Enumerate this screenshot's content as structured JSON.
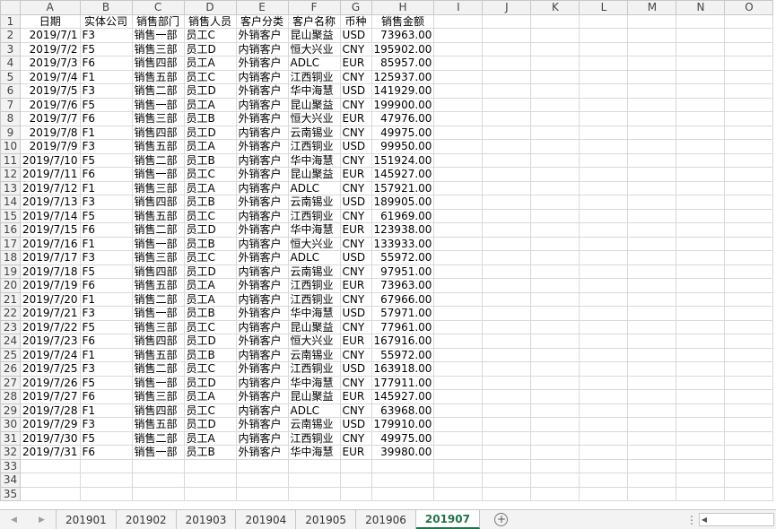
{
  "columns": [
    "A",
    "B",
    "C",
    "D",
    "E",
    "F",
    "G",
    "H",
    "I",
    "J",
    "K",
    "L",
    "M",
    "N",
    "O"
  ],
  "header_row": [
    "日期",
    "实体公司",
    "销售部门",
    "销售人员",
    "客户分类",
    "客户名称",
    "币种",
    "销售金额"
  ],
  "rows": [
    [
      "2019/7/1",
      "F3",
      "销售一部",
      "员工C",
      "外销客户",
      "昆山聚益",
      "USD",
      "73963.00"
    ],
    [
      "2019/7/2",
      "F5",
      "销售三部",
      "员工D",
      "内销客户",
      "恒大兴业",
      "CNY",
      "195902.00"
    ],
    [
      "2019/7/3",
      "F6",
      "销售四部",
      "员工A",
      "外销客户",
      "ADLC",
      "EUR",
      "85957.00"
    ],
    [
      "2019/7/4",
      "F1",
      "销售五部",
      "员工C",
      "内销客户",
      "江西铜业",
      "CNY",
      "125937.00"
    ],
    [
      "2019/7/5",
      "F3",
      "销售二部",
      "员工D",
      "外销客户",
      "华中海慧",
      "USD",
      "141929.00"
    ],
    [
      "2019/7/6",
      "F5",
      "销售一部",
      "员工A",
      "内销客户",
      "昆山聚益",
      "CNY",
      "199900.00"
    ],
    [
      "2019/7/7",
      "F6",
      "销售三部",
      "员工B",
      "外销客户",
      "恒大兴业",
      "EUR",
      "47976.00"
    ],
    [
      "2019/7/8",
      "F1",
      "销售四部",
      "员工D",
      "内销客户",
      "云南锡业",
      "CNY",
      "49975.00"
    ],
    [
      "2019/7/9",
      "F3",
      "销售五部",
      "员工A",
      "外销客户",
      "江西铜业",
      "USD",
      "99950.00"
    ],
    [
      "2019/7/10",
      "F5",
      "销售二部",
      "员工B",
      "内销客户",
      "华中海慧",
      "CNY",
      "151924.00"
    ],
    [
      "2019/7/11",
      "F6",
      "销售一部",
      "员工C",
      "外销客户",
      "昆山聚益",
      "EUR",
      "145927.00"
    ],
    [
      "2019/7/12",
      "F1",
      "销售三部",
      "员工A",
      "内销客户",
      "ADLC",
      "CNY",
      "157921.00"
    ],
    [
      "2019/7/13",
      "F3",
      "销售四部",
      "员工B",
      "外销客户",
      "云南锡业",
      "USD",
      "189905.00"
    ],
    [
      "2019/7/14",
      "F5",
      "销售五部",
      "员工C",
      "内销客户",
      "江西铜业",
      "CNY",
      "61969.00"
    ],
    [
      "2019/7/15",
      "F6",
      "销售二部",
      "员工D",
      "外销客户",
      "华中海慧",
      "EUR",
      "123938.00"
    ],
    [
      "2019/7/16",
      "F1",
      "销售一部",
      "员工B",
      "内销客户",
      "恒大兴业",
      "CNY",
      "133933.00"
    ],
    [
      "2019/7/17",
      "F3",
      "销售三部",
      "员工C",
      "外销客户",
      "ADLC",
      "USD",
      "55972.00"
    ],
    [
      "2019/7/18",
      "F5",
      "销售四部",
      "员工D",
      "内销客户",
      "云南锡业",
      "CNY",
      "97951.00"
    ],
    [
      "2019/7/19",
      "F6",
      "销售五部",
      "员工A",
      "外销客户",
      "江西铜业",
      "EUR",
      "73963.00"
    ],
    [
      "2019/7/20",
      "F1",
      "销售二部",
      "员工A",
      "内销客户",
      "江西铜业",
      "CNY",
      "67966.00"
    ],
    [
      "2019/7/21",
      "F3",
      "销售一部",
      "员工B",
      "外销客户",
      "华中海慧",
      "USD",
      "57971.00"
    ],
    [
      "2019/7/22",
      "F5",
      "销售三部",
      "员工C",
      "内销客户",
      "昆山聚益",
      "CNY",
      "77961.00"
    ],
    [
      "2019/7/23",
      "F6",
      "销售四部",
      "员工D",
      "外销客户",
      "恒大兴业",
      "EUR",
      "167916.00"
    ],
    [
      "2019/7/24",
      "F1",
      "销售五部",
      "员工B",
      "内销客户",
      "云南锡业",
      "CNY",
      "55972.00"
    ],
    [
      "2019/7/25",
      "F3",
      "销售二部",
      "员工C",
      "外销客户",
      "江西铜业",
      "USD",
      "163918.00"
    ],
    [
      "2019/7/26",
      "F5",
      "销售一部",
      "员工D",
      "内销客户",
      "华中海慧",
      "CNY",
      "177911.00"
    ],
    [
      "2019/7/27",
      "F6",
      "销售三部",
      "员工A",
      "外销客户",
      "昆山聚益",
      "EUR",
      "145927.00"
    ],
    [
      "2019/7/28",
      "F1",
      "销售四部",
      "员工C",
      "内销客户",
      "ADLC",
      "CNY",
      "63968.00"
    ],
    [
      "2019/7/29",
      "F3",
      "销售五部",
      "员工D",
      "外销客户",
      "云南锡业",
      "USD",
      "179910.00"
    ],
    [
      "2019/7/30",
      "F5",
      "销售二部",
      "员工A",
      "内销客户",
      "江西铜业",
      "CNY",
      "49975.00"
    ],
    [
      "2019/7/31",
      "F6",
      "销售一部",
      "员工B",
      "外销客户",
      "华中海慧",
      "EUR",
      "39980.00"
    ]
  ],
  "empty_row_numbers": [
    "33",
    "34",
    "35"
  ],
  "sheet_tabs": [
    "201901",
    "201902",
    "201903",
    "201904",
    "201905",
    "201906",
    "201907"
  ],
  "active_tab": "201907",
  "add_sheet_icon": "+",
  "more_icon": "⋮",
  "accent_color": "#217346"
}
